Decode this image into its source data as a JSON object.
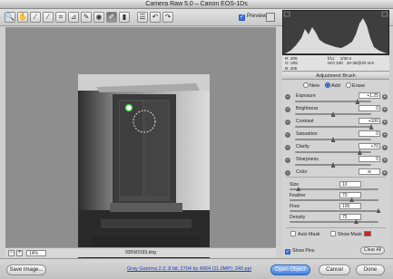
{
  "window": {
    "title": "Camera Raw 5.0  –  Canon EOS-1Ds"
  },
  "toolbar": {
    "tools": [
      {
        "name": "zoom-tool-icon",
        "glyph": "🔍"
      },
      {
        "name": "hand-tool-icon",
        "glyph": "✋"
      },
      {
        "name": "white-balance-tool-icon",
        "glyph": "⁄"
      },
      {
        "name": "color-sampler-tool-icon",
        "glyph": "⁄"
      },
      {
        "name": "crop-tool-icon",
        "glyph": "⌗"
      },
      {
        "name": "straighten-tool-icon",
        "glyph": "⊿"
      },
      {
        "name": "spot-removal-tool-icon",
        "glyph": "✎"
      },
      {
        "name": "red-eye-tool-icon",
        "glyph": "◉"
      },
      {
        "name": "adjustment-brush-icon",
        "glyph": "✐"
      },
      {
        "name": "graduated-filter-icon",
        "glyph": "▮"
      },
      {
        "name": "preferences-icon",
        "glyph": "☰"
      },
      {
        "name": "rotate-ccw-icon",
        "glyph": "↶"
      },
      {
        "name": "rotate-cw-icon",
        "glyph": "↷"
      }
    ],
    "preview_label": "Preview",
    "preview_checked": true
  },
  "readout": {
    "r": "R:  205",
    "g": "G:  205",
    "b": "B:  205",
    "aperture": "f/11",
    "shutter": "1/30 s",
    "iso": "ISO 100",
    "lens": "16-35@20 mm"
  },
  "panel": {
    "title": "Adjustment Brush",
    "modes": [
      "New",
      "Add",
      "Erase"
    ],
    "selected_mode": "Add",
    "sliders": [
      {
        "label": "Exposure",
        "value": "+1.25",
        "pos": 0.82
      },
      {
        "label": "Brightness",
        "value": "0",
        "pos": 0.5
      },
      {
        "label": "Contrast",
        "value": "+100",
        "pos": 1.0
      },
      {
        "label": "Saturation",
        "value": "0",
        "pos": 0.5
      },
      {
        "label": "Clarity",
        "value": "+70",
        "pos": 0.85
      },
      {
        "label": "Sharpness",
        "value": "0",
        "pos": 0.5
      }
    ],
    "color_label": "Color",
    "brush": [
      {
        "label": "Size",
        "value": "10",
        "pos": 0.1
      },
      {
        "label": "Feather",
        "value": "70",
        "pos": 0.7
      },
      {
        "label": "Flow",
        "value": "100",
        "pos": 1.0
      },
      {
        "label": "Density",
        "value": "75",
        "pos": 0.75
      }
    ],
    "auto_mask": "Auto Mask",
    "show_mask": "Show Mask",
    "mask_color": "#e31b1b",
    "show_pins": "Show Pins",
    "clear_all": "Clear All"
  },
  "status": {
    "zoom": "14%",
    "filename": "935W3193.dng"
  },
  "footer": {
    "save": "Save Image...",
    "info": "Gray Gamma 2.2; 8 bit; 2704 by 4064 (11.0MP); 240 ppi",
    "open": "Open Object",
    "cancel": "Cancel",
    "done": "Done"
  }
}
